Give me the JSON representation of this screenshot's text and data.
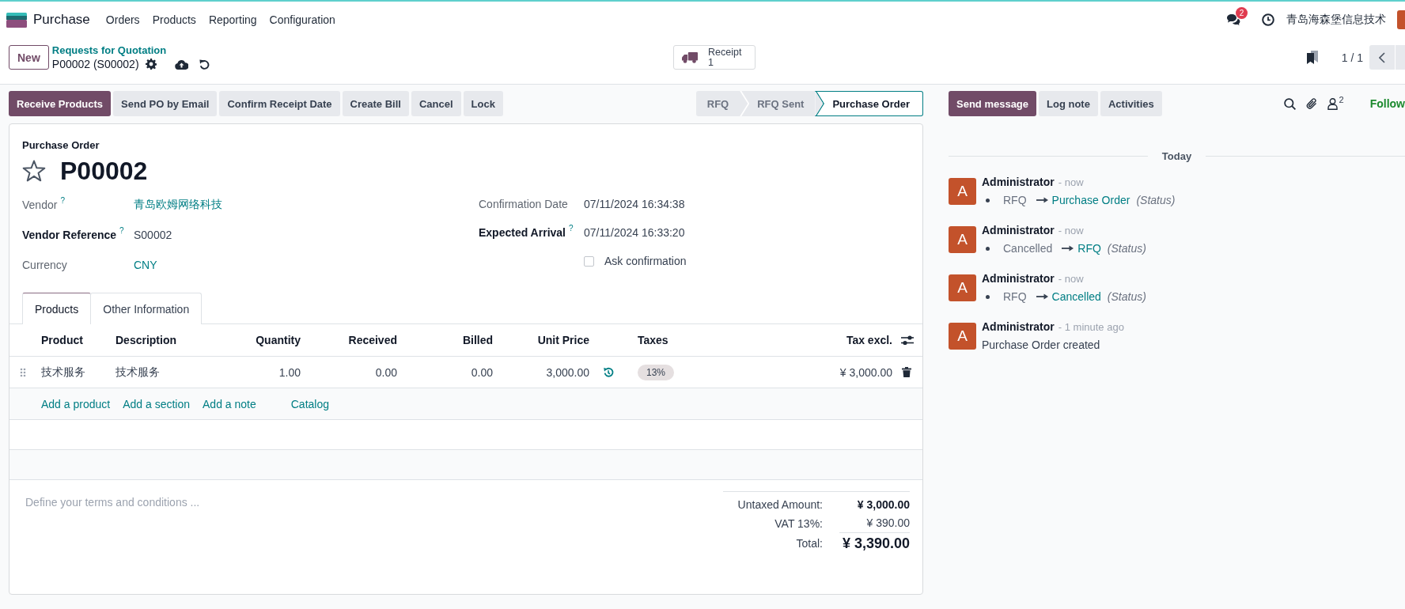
{
  "navbar": {
    "app_name": "Purchase",
    "menu": [
      "Orders",
      "Products",
      "Reporting",
      "Configuration"
    ],
    "message_count": "2",
    "company": "青岛海森堡信息技术"
  },
  "control_panel": {
    "new_button": "New",
    "breadcrumb": "Requests for Quotation",
    "record": "P00002 (S00002)",
    "smart_button": {
      "label": "Receipt",
      "count": "1"
    },
    "pager": "1 / 1"
  },
  "actions": [
    {
      "label": "Receive Products",
      "primary": true
    },
    {
      "label": "Send PO by Email",
      "primary": false
    },
    {
      "label": "Confirm Receipt Date",
      "primary": false
    },
    {
      "label": "Create Bill",
      "primary": false
    },
    {
      "label": "Cancel",
      "primary": false
    },
    {
      "label": "Lock",
      "primary": false
    }
  ],
  "statusbar": [
    {
      "label": "RFQ",
      "selected": false
    },
    {
      "label": "RFQ Sent",
      "selected": false
    },
    {
      "label": "Purchase Order",
      "selected": true
    }
  ],
  "form": {
    "type_label": "Purchase Order",
    "name": "P00002",
    "starred": false,
    "left_fields": [
      {
        "kind": "link",
        "label": "Vendor",
        "help": "?",
        "value": "青岛欧姆网络科技"
      },
      {
        "kind": "input",
        "label": "Vendor Reference",
        "help": "?",
        "value": "S00002"
      },
      {
        "kind": "link",
        "label": "Currency",
        "value": "CNY"
      }
    ],
    "right_fields": [
      {
        "kind": "text",
        "label": "Confirmation Date",
        "value": "07/11/2024 16:34:38"
      },
      {
        "kind": "input",
        "label": "Expected Arrival",
        "help": "?",
        "value": "07/11/2024 16:33:20"
      },
      {
        "kind": "checkbox",
        "label": "Ask confirmation",
        "checked": false
      }
    ],
    "tabs": [
      {
        "label": "Products",
        "selected": true
      },
      {
        "label": "Other Information",
        "selected": false
      }
    ],
    "table": {
      "columns": [
        "Product",
        "Description",
        "Quantity",
        "Received",
        "Billed",
        "Unit Price",
        "Taxes",
        "Tax excl."
      ],
      "rows": [
        {
          "product": "技术服务",
          "description": "技术服务",
          "quantity": "1.00",
          "received": "0.00",
          "billed": "0.00",
          "unit_price": "3,000.00",
          "taxes": [
            "13%"
          ],
          "subtotal": "¥ 3,000.00"
        }
      ],
      "add_links": [
        "Add a product",
        "Add a section",
        "Add a note",
        "Catalog"
      ]
    },
    "terms": {
      "placeholder": "Define your terms and conditions ..."
    },
    "totals": [
      {
        "kind": "subtotal",
        "label": "Untaxed Amount:",
        "value": "¥ 3,000.00"
      },
      {
        "kind": "tax",
        "label": "VAT 13%:",
        "value": "¥ 390.00"
      },
      {
        "kind": "total",
        "label": "Total:",
        "value": "¥ 3,390.00"
      }
    ]
  },
  "chatter": {
    "buttons": [
      {
        "label": "Send message",
        "primary": true
      },
      {
        "label": "Log note",
        "primary": false
      },
      {
        "label": "Activities",
        "primary": false
      }
    ],
    "followers_count": "2",
    "follow": "Follow",
    "date_separator": "Today",
    "messages": [
      {
        "kind": "tracking",
        "avatar": "A",
        "author": "Administrator",
        "time": "- now",
        "old_value": "RFQ",
        "new_value": "Purchase Order",
        "field": "(Status)"
      },
      {
        "kind": "tracking",
        "avatar": "A",
        "author": "Administrator",
        "time": "- now",
        "old_value": "Cancelled",
        "new_value": "RFQ",
        "field": "(Status)"
      },
      {
        "kind": "tracking",
        "avatar": "A",
        "author": "Administrator",
        "time": "- now",
        "old_value": "RFQ",
        "new_value": "Cancelled",
        "field": "(Status)"
      },
      {
        "kind": "note",
        "avatar": "A",
        "author": "Administrator",
        "time": "- 1 minute ago",
        "body": "Purchase Order created"
      }
    ]
  }
}
